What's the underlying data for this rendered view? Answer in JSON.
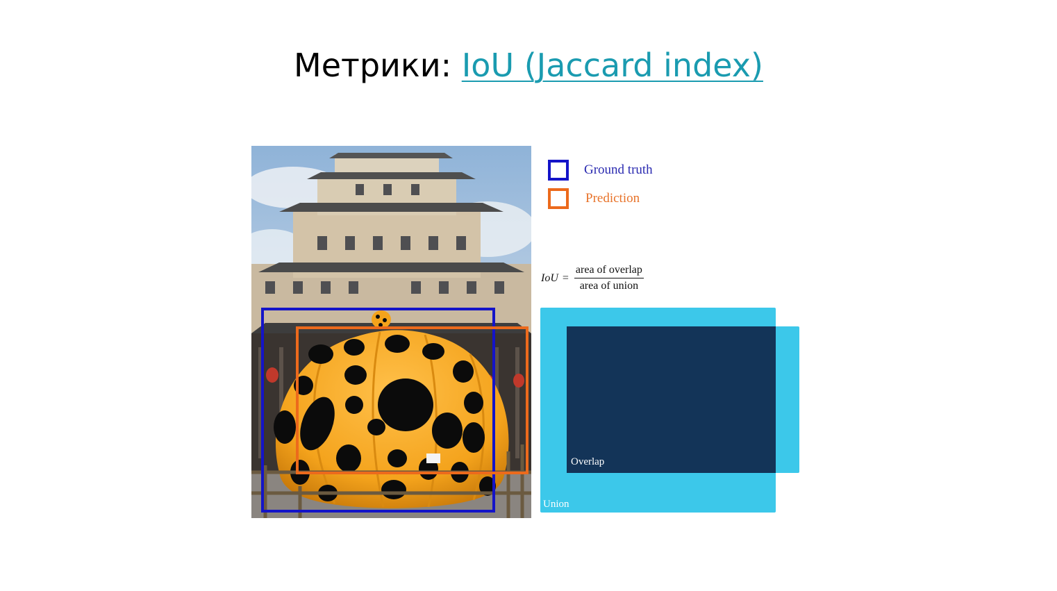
{
  "title": {
    "prefix": "Метрики: ",
    "link_text": "IoU (Jaccard index)"
  },
  "legend": {
    "ground_truth": {
      "label": "Ground truth",
      "color": "#1414c8"
    },
    "prediction": {
      "label": "Prediction",
      "color": "#ec6a1c"
    }
  },
  "formula": {
    "lhs": "IoU",
    "eq": "=",
    "numerator": "area of overlap",
    "denominator": "area of union"
  },
  "diagram": {
    "overlap_label": "Overlap",
    "union_label": "Union",
    "union_color": "#3cc8ea",
    "overlap_color": "#133458"
  },
  "colors": {
    "link": "#1a9bb0"
  }
}
